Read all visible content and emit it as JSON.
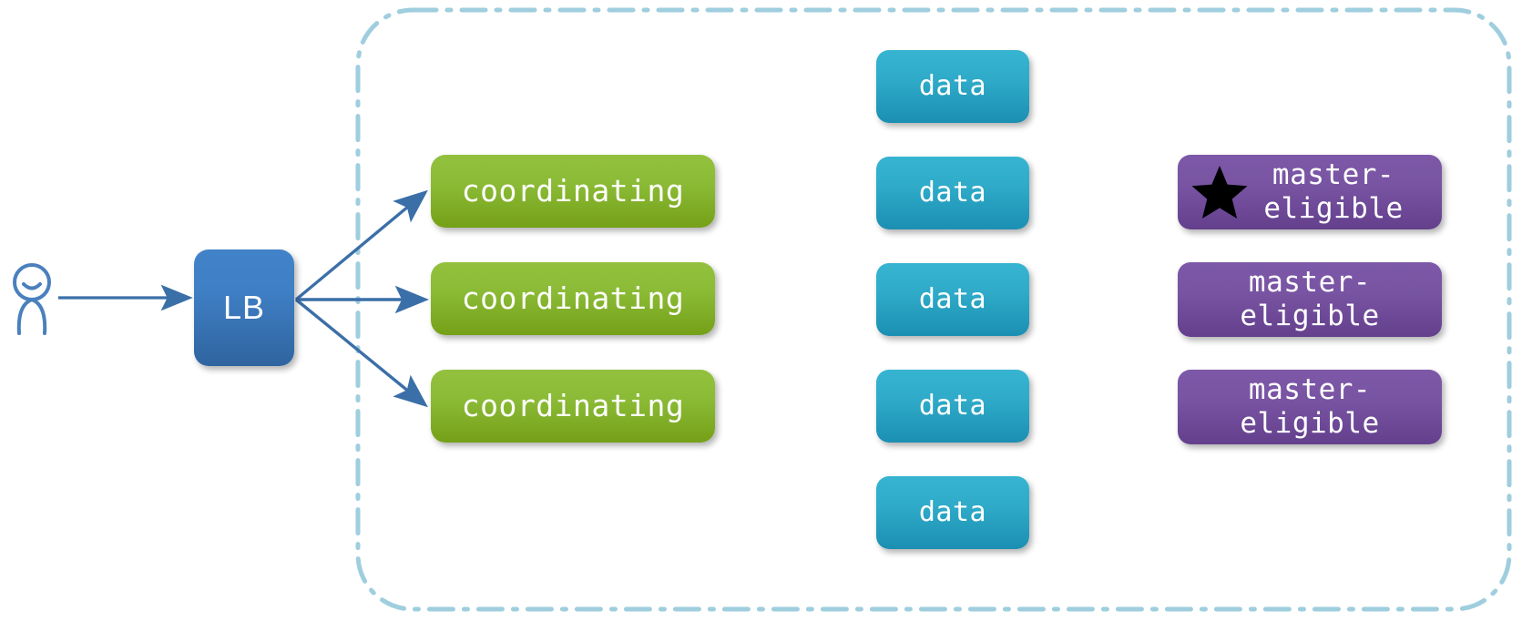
{
  "diagram": {
    "title": "Elasticsearch cluster node roles topology",
    "type": "architecture-diagram",
    "background_color": "#ffffff",
    "cluster_boundary": {
      "style": "dash-dot rounded rectangle",
      "color": "#9fcede",
      "stroke_width": 4,
      "corner_radius": 60
    }
  },
  "actor": {
    "name": "user",
    "label": "",
    "color": "#4a80bd"
  },
  "load_balancer": {
    "label": "LB",
    "color_top": "#4282c8",
    "color_bottom": "#2f649f"
  },
  "arrows": {
    "color": "#3b6fa8",
    "count": 4,
    "from_actor_to_lb": 1,
    "from_lb_to_coordinating": 3
  },
  "columns": {
    "coordinating": {
      "role": "coordinating",
      "color_top": "#93c13f",
      "color_bottom": "#75a018",
      "nodes": [
        {
          "label": "coordinating"
        },
        {
          "label": "coordinating"
        },
        {
          "label": "coordinating"
        }
      ]
    },
    "data": {
      "role": "data",
      "color_top": "#36b4d1",
      "color_bottom": "#1b8fb2",
      "nodes": [
        {
          "label": "data"
        },
        {
          "label": "data"
        },
        {
          "label": "data"
        },
        {
          "label": "data"
        },
        {
          "label": "data"
        }
      ]
    },
    "master_eligible": {
      "role": "master-eligible",
      "color_top": "#7d58a8",
      "color_bottom": "#633f8c",
      "star_color": "#000000",
      "star_meaning": "elected master",
      "nodes": [
        {
          "line1": "master-",
          "line2": "eligible",
          "star": true
        },
        {
          "line1": "master-",
          "line2": "eligible",
          "star": false
        },
        {
          "line1": "master-",
          "line2": "eligible",
          "star": false
        }
      ]
    }
  }
}
